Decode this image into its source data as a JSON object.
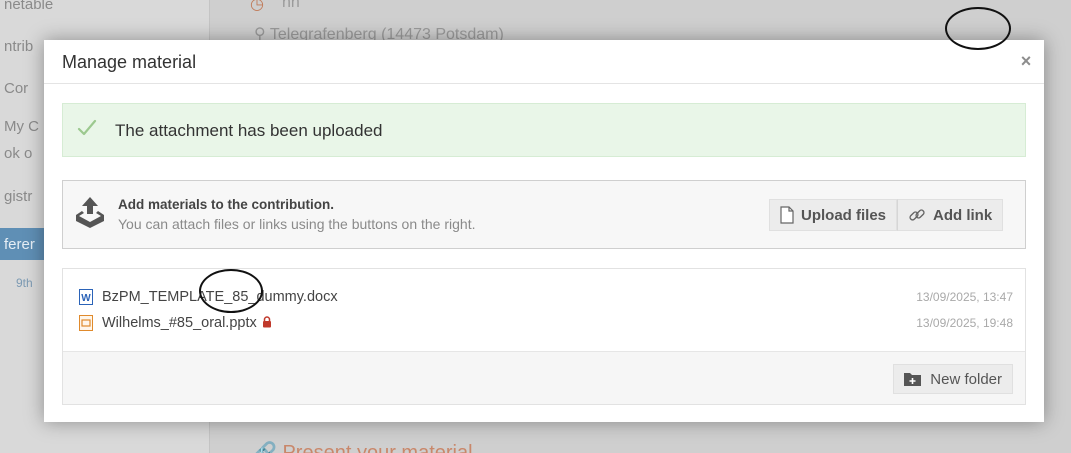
{
  "background": {
    "sidebar_items": [
      "netable",
      "ntrib",
      "Cor",
      "My C",
      "ok o",
      "gistr"
    ],
    "sidebar_active": "ferer",
    "sidebar_small": "9th",
    "time_text": "nn",
    "location_text": "Telegrafenberg (14473 Potsdam)",
    "bottom_link": "Present your material"
  },
  "modal": {
    "title": "Manage material",
    "close_glyph": "×",
    "success_message": "The attachment has been uploaded",
    "add_title": "Add materials to the contribution.",
    "add_subtitle": "You can attach files or links using the buttons on the right.",
    "upload_label": "Upload files",
    "add_link_label": "Add link",
    "new_folder_label": "New folder"
  },
  "files": [
    {
      "name": "BzPM_TEMPLATE_85_dummy.docx",
      "date": "13/09/2025, 13:47",
      "icon": "word-file-icon",
      "locked": false
    },
    {
      "name": "Wilhelms_#85_oral.pptx",
      "date": "13/09/2025, 19:48",
      "icon": "powerpoint-file-icon",
      "locked": true
    }
  ],
  "colors": {
    "success_bg": "#e9f6e8",
    "success_check": "#9cc98f",
    "lock": "#c0392b",
    "word_icon": "#2b63b8",
    "ppt_icon": "#e08a2c"
  }
}
